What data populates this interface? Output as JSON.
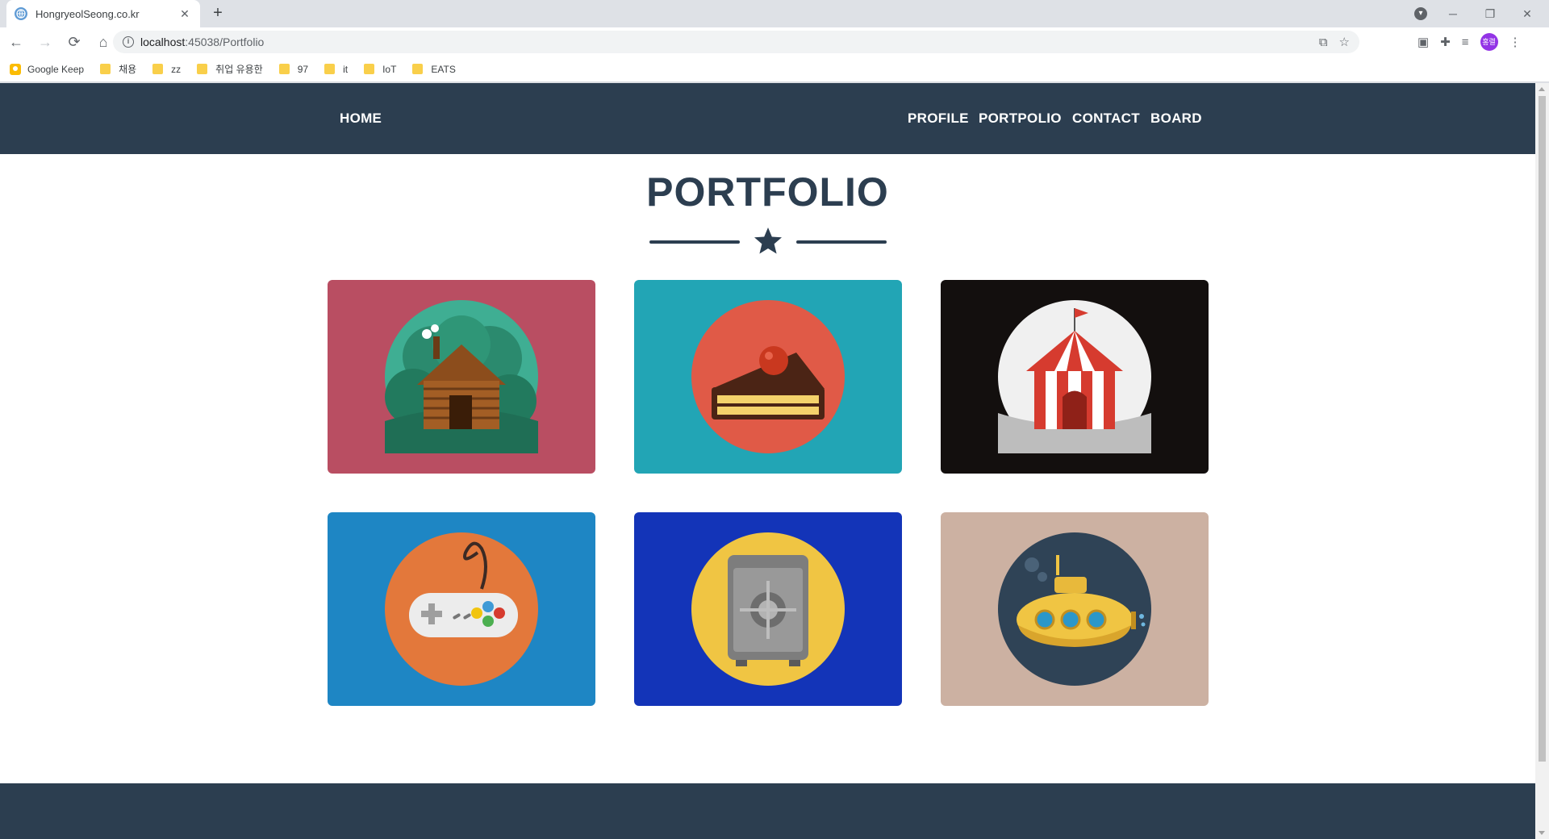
{
  "browser": {
    "tab_title": "HongryeolSeong.co.kr",
    "tab_close": "✕",
    "new_tab": "+",
    "url_host": "localhost",
    "url_path": ":45038/Portfolio",
    "window_controls": {
      "minimize": "─",
      "restore": "❐",
      "close": "✕"
    },
    "avatar_text": "홍렬",
    "bookmarks": [
      "Google Keep",
      "채용",
      "zz",
      "취업 유용한",
      "97",
      "it",
      "IoT",
      "EATS"
    ]
  },
  "site": {
    "nav": {
      "home": "HOME",
      "profile": "PROFILE",
      "portfolio": "PORTPOLIO",
      "contact": "CONTACT",
      "board": "BOARD"
    },
    "heading": "PORTFOLIO",
    "colors": {
      "nav_bg": "#2c3e50",
      "heading": "#2c3e50"
    },
    "portfolio_items": [
      {
        "icon": "cabin-icon",
        "bg": "#b94e62"
      },
      {
        "icon": "cake-icon",
        "bg": "#22a5b5"
      },
      {
        "icon": "circus-tent-icon",
        "bg": "#130f0e"
      },
      {
        "icon": "game-controller-icon",
        "bg": "#1e86c4"
      },
      {
        "icon": "safe-icon",
        "bg": "#1334b8"
      },
      {
        "icon": "submarine-icon",
        "bg": "#ccb1a2"
      }
    ]
  }
}
